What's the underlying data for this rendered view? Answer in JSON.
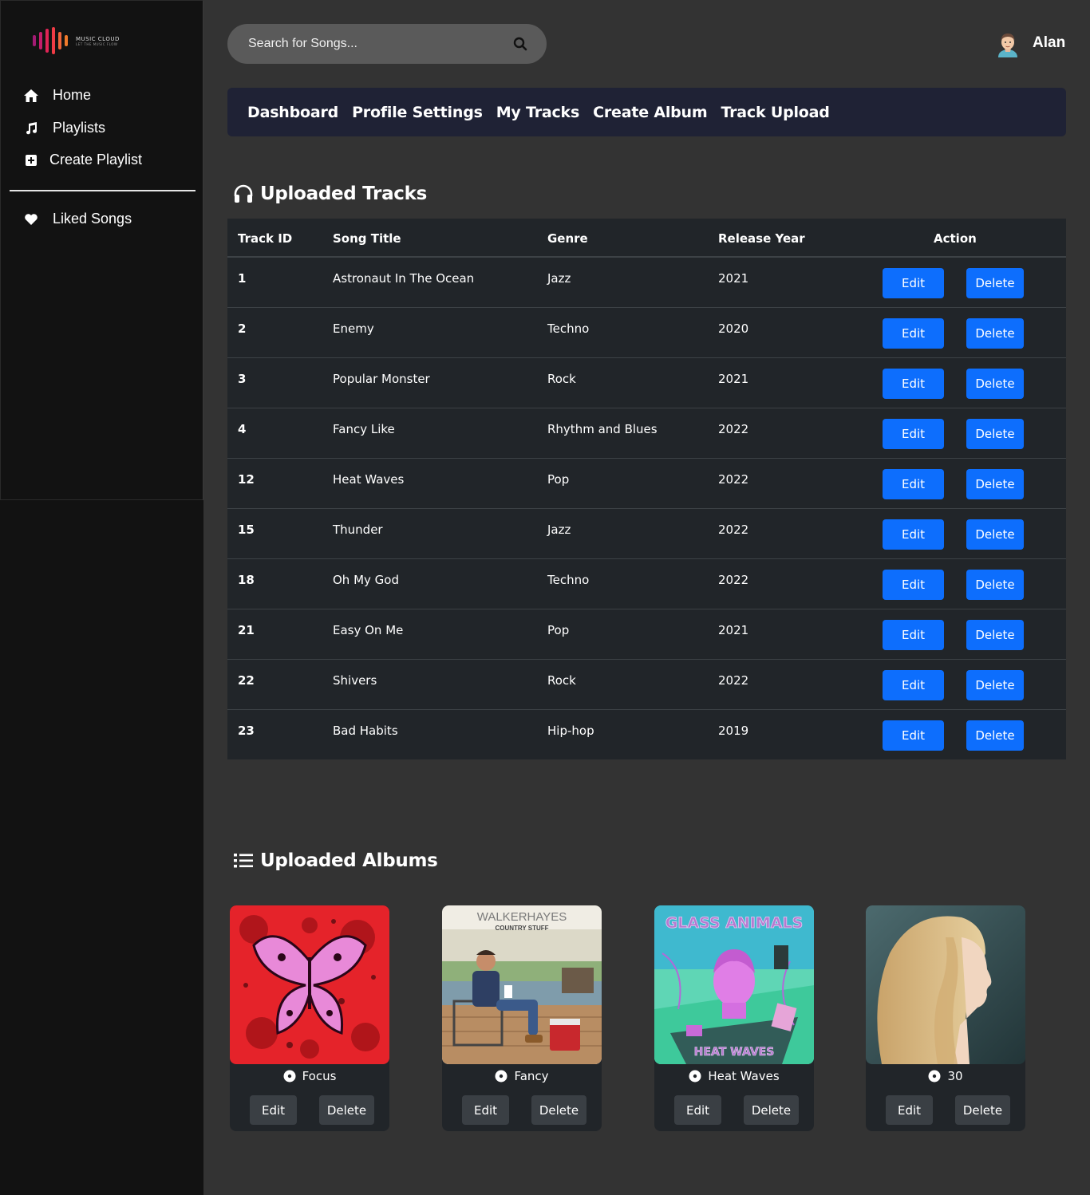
{
  "brand": {
    "name": "MUSIC CLOUD",
    "tagline": "LET THE MUSIC FLOW",
    "colors": [
      "#a31b73",
      "#c41d6a",
      "#e02456",
      "#ef3b45",
      "#f0653a",
      "#f07a2b"
    ]
  },
  "sidebar": {
    "items": [
      {
        "label": "Home",
        "icon": "home-icon"
      },
      {
        "label": "Playlists",
        "icon": "music-note-icon"
      },
      {
        "label": "Create Playlist",
        "icon": "plus-square-icon"
      },
      {
        "label": "Liked Songs",
        "icon": "heart-icon"
      }
    ]
  },
  "search": {
    "placeholder": "Search for Songs...",
    "icon": "search-icon"
  },
  "user": {
    "name": "Alan",
    "icon": "avatar"
  },
  "tabs": [
    "Dashboard",
    "Profile Settings",
    "My Tracks",
    "Create Album",
    "Track Upload"
  ],
  "tracks_section": {
    "title": "Uploaded Tracks",
    "icon": "headphones-icon",
    "columns": [
      "Track ID",
      "Song Title",
      "Genre",
      "Release Year",
      "Action"
    ],
    "edit_label": "Edit",
    "delete_label": "Delete",
    "rows": [
      {
        "id": "1",
        "title": "Astronaut In The Ocean",
        "genre": "Jazz",
        "year": "2021"
      },
      {
        "id": "2",
        "title": "Enemy",
        "genre": "Techno",
        "year": "2020"
      },
      {
        "id": "3",
        "title": "Popular Monster",
        "genre": "Rock",
        "year": "2021"
      },
      {
        "id": "4",
        "title": "Fancy Like",
        "genre": "Rhythm and Blues",
        "year": "2022"
      },
      {
        "id": "12",
        "title": "Heat Waves",
        "genre": "Pop",
        "year": "2022"
      },
      {
        "id": "15",
        "title": "Thunder",
        "genre": "Jazz",
        "year": "2022"
      },
      {
        "id": "18",
        "title": "Oh My God",
        "genre": "Techno",
        "year": "2022"
      },
      {
        "id": "21",
        "title": "Easy On Me",
        "genre": "Pop",
        "year": "2021"
      },
      {
        "id": "22",
        "title": "Shivers",
        "genre": "Rock",
        "year": "2022"
      },
      {
        "id": "23",
        "title": "Bad Habits",
        "genre": "Hip-hop",
        "year": "2019"
      }
    ]
  },
  "albums_section": {
    "title": "Uploaded Albums",
    "icon": "list-icon",
    "edit_label": "Edit",
    "delete_label": "Delete",
    "albums": [
      {
        "title": "Focus",
        "cover": "butterfly-cover"
      },
      {
        "title": "Fancy",
        "cover": "walker-hayes-cover",
        "cover_text": [
          "WALKERHAYES",
          "COUNTRY STUFF"
        ]
      },
      {
        "title": "Heat Waves",
        "cover": "glass-animals-cover",
        "cover_text": [
          "GLASS ANIMALS",
          "HEAT WAVES"
        ]
      },
      {
        "title": "30",
        "cover": "portrait-cover"
      }
    ]
  },
  "accent": "#0d6efd"
}
